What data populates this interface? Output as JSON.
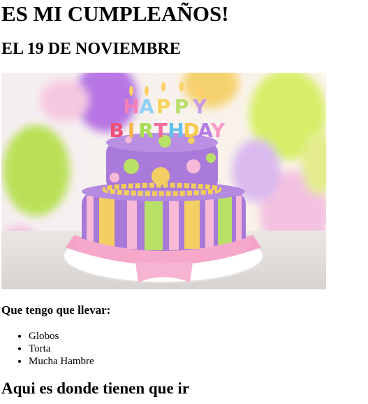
{
  "title": "ES MI CUMPLEAÑOS!",
  "date_heading": "EL 19 DE NOVIEMBRE",
  "image": {
    "candle_letters_top": [
      "H",
      "A",
      "P",
      "P",
      "Y"
    ],
    "candle_letters_bottom": [
      "B",
      "I",
      "R",
      "T",
      "H",
      "D",
      "A",
      "Y"
    ]
  },
  "bring_heading": "Que tengo que llevar:",
  "bring_items": [
    "Globos",
    "Torta",
    "Mucha Hambre"
  ],
  "where_heading": "Aqui es donde tienen que ir"
}
